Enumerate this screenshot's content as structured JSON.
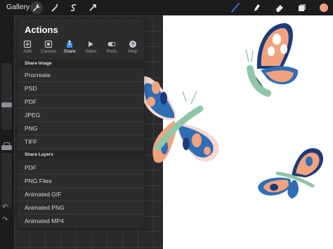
{
  "toolbar": {
    "gallery_label": "Gallery",
    "left_tools": [
      "wrench-icon",
      "magic-wand-icon",
      "selection-icon",
      "transform-icon"
    ],
    "right_tools": [
      "brush-icon",
      "smudge-icon",
      "eraser-icon",
      "layers-icon",
      "color-swatch"
    ],
    "active_color": "#f2a27e",
    "brush_color": "#2f6fd6"
  },
  "actions": {
    "title": "Actions",
    "tabs": [
      {
        "label": "Add",
        "icon": "add-icon"
      },
      {
        "label": "Canvas",
        "icon": "canvas-icon"
      },
      {
        "label": "Share",
        "icon": "share-icon",
        "active": true
      },
      {
        "label": "Video",
        "icon": "video-icon"
      },
      {
        "label": "Prefs",
        "icon": "prefs-toggle-icon"
      },
      {
        "label": "Help",
        "icon": "help-icon"
      }
    ],
    "share_image_header": "Share Image",
    "share_image_items": [
      "Procreate",
      "PSD",
      "PDF",
      "JPEG",
      "PNG",
      "TIFF"
    ],
    "share_layers_header": "Share Layers",
    "share_layers_items": [
      "PDF",
      "PNG Files",
      "Animated GIF",
      "Animated PNG",
      "Animated MP4"
    ]
  },
  "colors": {
    "wing_blue": "#2f6db5",
    "wing_navy": "#1d3b78",
    "wing_peach": "#f2a27e",
    "body_green": "#8fc7a8"
  }
}
